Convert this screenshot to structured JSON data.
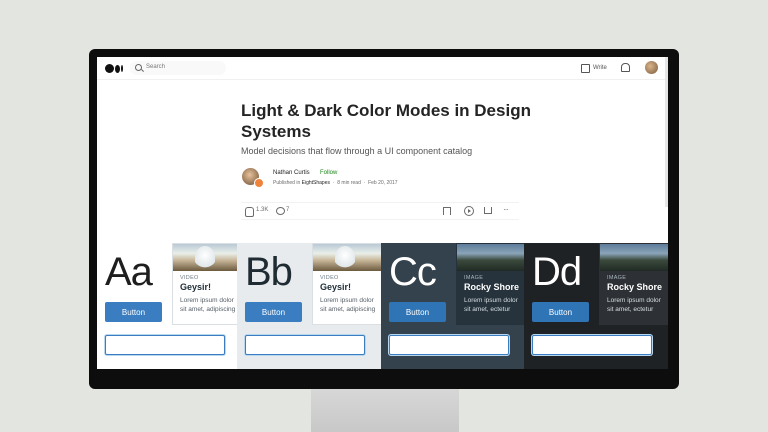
{
  "nav": {
    "search_placeholder": "Search",
    "write_label": "Write"
  },
  "article": {
    "title": "Light & Dark Color Modes in Design Systems",
    "subtitle": "Model decisions that flow through a UI component catalog",
    "author": "Nathan Curtis",
    "follow_label": "Follow",
    "published_prefix": "Published in",
    "publication": "EightShapes",
    "read_time": "8 min read",
    "date": "Feb 20, 2017",
    "claps": "1.3K",
    "responses": "7",
    "more": "···"
  },
  "hero": {
    "panels": [
      {
        "glyph": "Aa",
        "button": "Button",
        "card_tag": "VIDEO",
        "card_title": "Geysir!",
        "card_line1": "Lorem ipsum dolor",
        "card_line2": "sit amet, adipiscing"
      },
      {
        "glyph": "Bb",
        "button": "Button",
        "card_tag": "VIDEO",
        "card_title": "Geysir!",
        "card_line1": "Lorem ipsum dolor",
        "card_line2": "sit amet, adipiscing"
      },
      {
        "glyph": "Cc",
        "button": "Button",
        "card_tag": "IMAGE",
        "card_title": "Rocky Shore",
        "card_line1": "Lorem ipsum dolor",
        "card_line2": "sit amet, ectetur"
      },
      {
        "glyph": "Dd",
        "button": "Button",
        "card_tag": "IMAGE",
        "card_title": "Rocky Shore",
        "card_line1": "Lorem ipsum dolor",
        "card_line2": "sit amet, ectetur"
      }
    ]
  },
  "colors": {
    "brand_green": "#1a8917",
    "button_blue": "#3a7dc0",
    "monitor_bezel": "#0d0d0d",
    "backdrop": "#e2e5e0",
    "panel_light": "#ffffff",
    "panel_gray": "#e7ebee",
    "panel_slate": "#33424d",
    "panel_dark": "#1f2225"
  },
  "icons": [
    "medium-logo-icon",
    "search-icon",
    "write-icon",
    "bell-icon",
    "avatar",
    "clap-icon",
    "comment-icon",
    "save-icon",
    "play-icon",
    "share-icon",
    "more-icon"
  ]
}
